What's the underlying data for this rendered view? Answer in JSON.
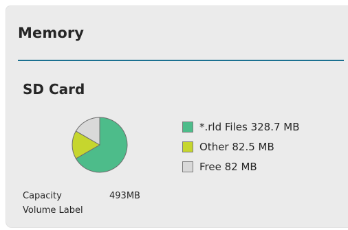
{
  "panel": {
    "title": "Memory"
  },
  "sd_card": {
    "title": "SD Card",
    "capacity_label": "Capacity",
    "capacity_value": "493MB",
    "volume_label": "Volume Label",
    "volume_value": ""
  },
  "colors": {
    "accent_line": "#1b7090",
    "rld_files": "#4dbc8a",
    "other": "#c6d62e",
    "free": "#d9d9d9"
  },
  "chart_data": {
    "type": "pie",
    "legend_placement": "right",
    "slices": [
      {
        "label": "*.rld Files 328.7 MB",
        "name": "*.rld Files",
        "value": 328.7,
        "unit": "MB",
        "color": "#4dbc8a"
      },
      {
        "label": "Other 82.5 MB",
        "name": "Other",
        "value": 82.5,
        "unit": "MB",
        "color": "#c6d62e"
      },
      {
        "label": "Free 82 MB",
        "name": "Free",
        "value": 82,
        "unit": "MB",
        "color": "#d9d9d9"
      }
    ]
  }
}
